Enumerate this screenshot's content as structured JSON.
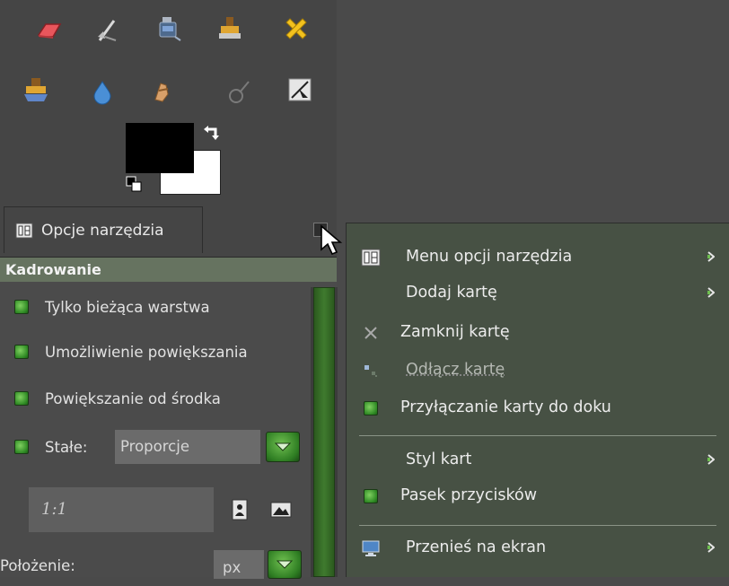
{
  "toolbox": {
    "tools_row1": [
      "eraser-icon",
      "smudge-icon",
      "ink-icon",
      "clone-icon",
      "heal-icon"
    ],
    "tools_row2": [
      "perspective-clone-icon",
      "blur-sharpen-icon",
      "smudge-hand-icon",
      "dodge-burn-icon",
      "measure-icon"
    ],
    "fg_color": "#000000",
    "bg_color": "#ffffff"
  },
  "tab": {
    "label": "Opcje narzędzia"
  },
  "options": {
    "header": "Kadrowanie",
    "only_current_layer": "Tylko bieżąca warstwa",
    "allow_growing": "Umożliwienie powiększania",
    "expand_from_center": "Powiększanie od środka",
    "fixed_label": "Stałe:",
    "fixed_value": "Proporcje",
    "ratio_value": "1:1",
    "position_label": "Położenie:",
    "unit_value": "px"
  },
  "menu": {
    "items": [
      {
        "label": "Menu opcji narzędzia",
        "has_submenu": true
      },
      {
        "label": "Dodaj kartę",
        "has_submenu": true
      },
      {
        "label": "Zamknij kartę",
        "has_submenu": false
      },
      {
        "label": "Odłącz kartę",
        "has_submenu": false,
        "disabled": true
      },
      {
        "label": "Przyłączanie karty do doku",
        "has_submenu": false
      },
      {
        "label": "Styl kart",
        "has_submenu": true
      },
      {
        "label": "Pasek przycisków",
        "has_submenu": false
      },
      {
        "label": "Przenieś na ekran",
        "has_submenu": true
      }
    ]
  },
  "colors": {
    "menu_bg": "#475144",
    "panel_header": "#667360",
    "accent_green": "#3f8a2c"
  }
}
